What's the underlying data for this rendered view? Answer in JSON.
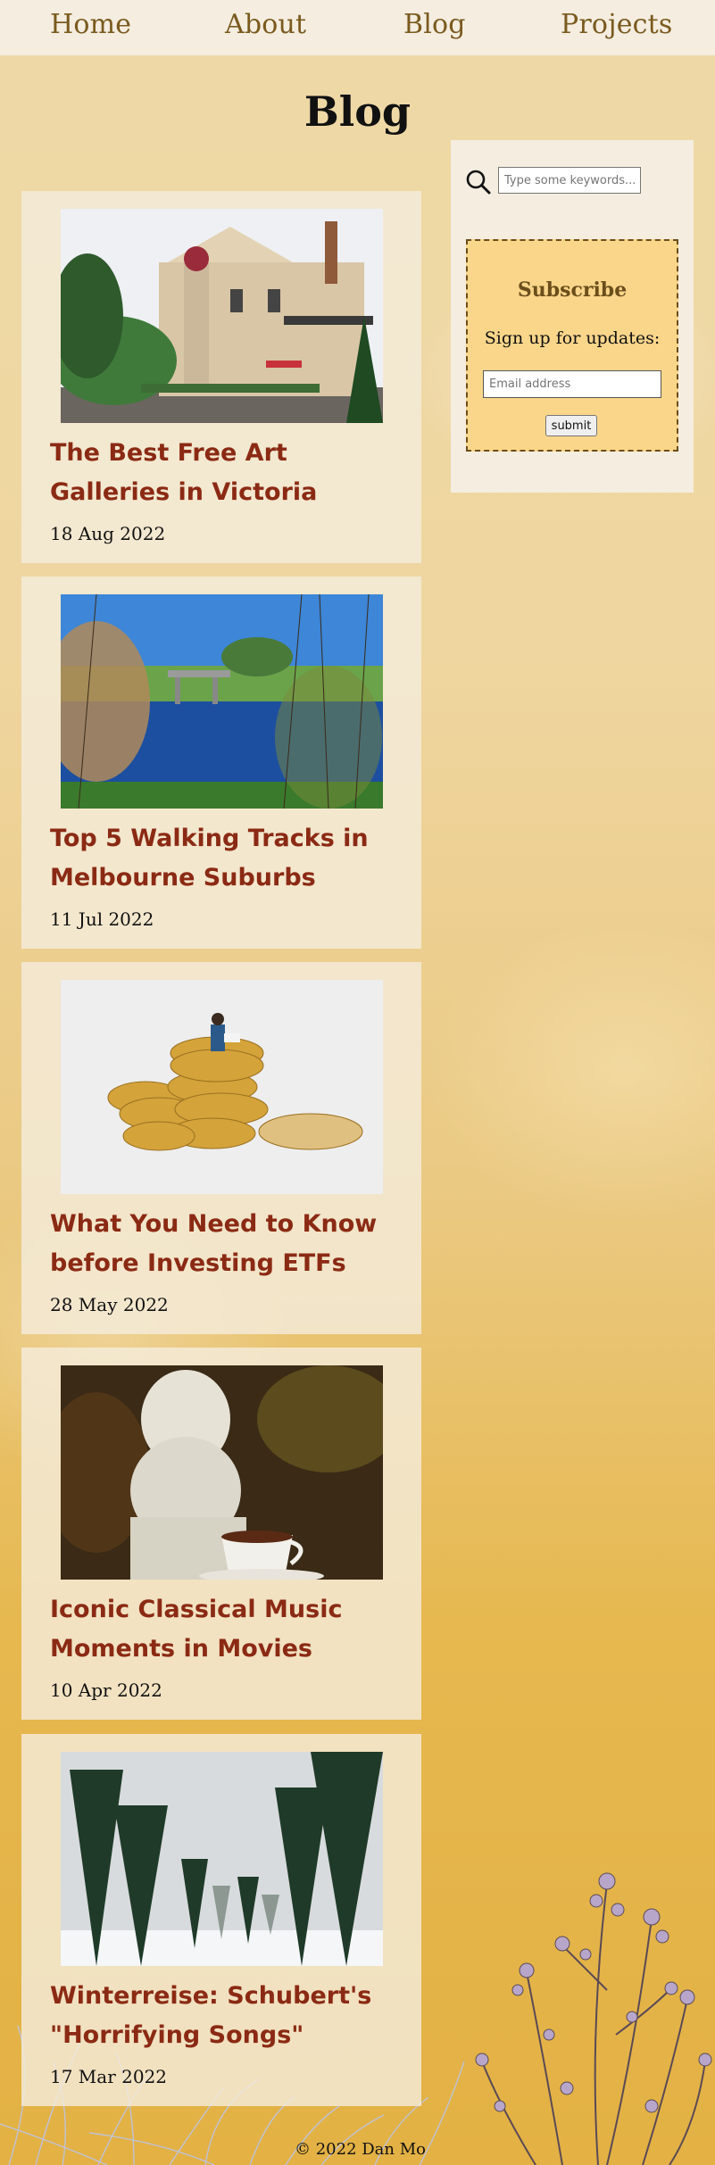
{
  "nav": {
    "items": [
      {
        "label": "Home"
      },
      {
        "label": "About"
      },
      {
        "label": "Blog"
      },
      {
        "label": "Projects"
      }
    ]
  },
  "page": {
    "title": "Blog"
  },
  "posts": [
    {
      "title": "The Best Free Art Galleries in Victoria",
      "date": "18 Aug 2022",
      "image": "victorian-mansion-photo"
    },
    {
      "title": "Top 5 Walking Tracks in Melbourne Suburbs",
      "date": "11 Jul 2022",
      "image": "river-bridge-photo"
    },
    {
      "title": "What You Need to Know before Investing ETFs",
      "date": "28 May 2022",
      "image": "coins-figurine-photo"
    },
    {
      "title": "Iconic Classical Music Moments in Movies",
      "date": "10 Apr 2022",
      "image": "beethoven-bust-coffee-photo"
    },
    {
      "title": "Winterreise: Schubert's \"Horrifying Songs\"",
      "date": "17 Mar 2022",
      "image": "snowy-forest-photo"
    }
  ],
  "sidebar": {
    "search": {
      "placeholder": "Type some keywords...",
      "icon": "search-icon"
    },
    "subscribe": {
      "heading": "Subscribe",
      "text": "Sign up for updates:",
      "email_placeholder": "Email address",
      "button_label": "submit"
    }
  },
  "footer": {
    "text": "© 2022 Dan Mo"
  },
  "colors": {
    "nav_background": "#f4ede0",
    "nav_link": "#7a5a1e",
    "post_title": "#8b2a14",
    "subscribe_background": "#fad68b",
    "subscribe_border": "#6b4e1b"
  }
}
